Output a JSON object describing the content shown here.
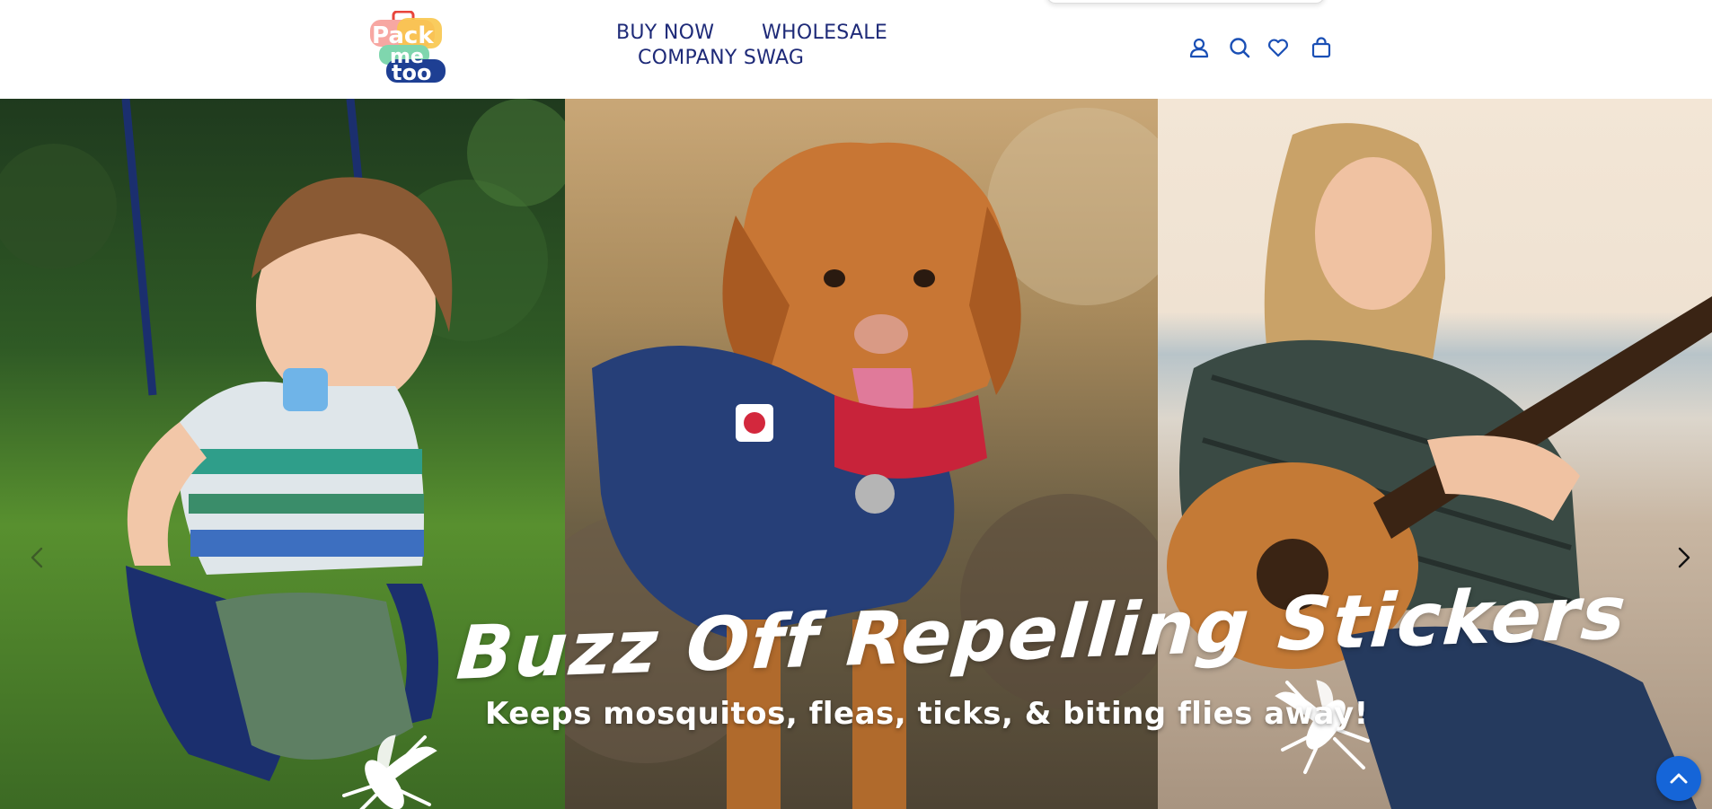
{
  "brand": {
    "logo_line1": "Pack",
    "logo_line2": "me",
    "logo_line3": "too"
  },
  "nav": {
    "items": [
      {
        "label": "BUY NOW"
      },
      {
        "label": "WHOLESALE"
      },
      {
        "label": "COMPANY SWAG"
      }
    ]
  },
  "header_icons": [
    "account-icon",
    "search-icon",
    "wishlist-heart-icon",
    "cart-bag-icon"
  ],
  "hero": {
    "title": "Buzz Off Repelling Stickers",
    "subtitle": "Keeps mosquitos, fleas, ticks, & biting flies away!",
    "panels": [
      "child-on-swing-photo",
      "dog-in-jacket-photo",
      "woman-with-guitar-photo"
    ],
    "controls": [
      "chevron-left-icon",
      "chevron-right-icon"
    ]
  },
  "back_to_top_icon": "chevron-up-icon",
  "colors": {
    "nav_text": "#1e2a78",
    "icon_blue": "#1a4fb5",
    "back_to_top": "#1565d8",
    "hero_text": "#ffffff"
  }
}
